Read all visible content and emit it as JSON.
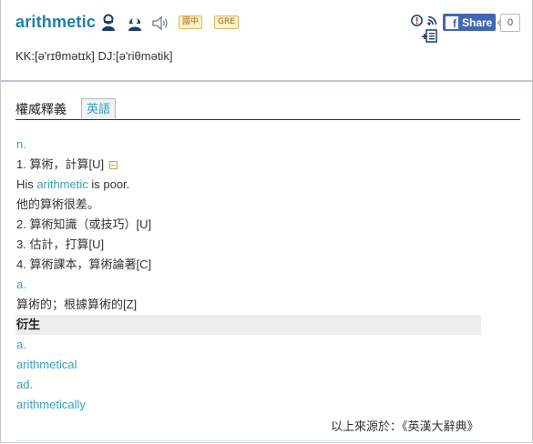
{
  "header": {
    "word": "arithmetic",
    "badges": [
      "國中",
      "GRE"
    ],
    "pronunciation": "KK:[ə'rɪθmətɪk] DJ:[ə'riθmətik]",
    "share_label": "Share",
    "share_count": "0",
    "icons": [
      "male-voice-icon",
      "female-voice-icon",
      "speaker-icon",
      "report-icon",
      "rss-icon",
      "bookmark-add-icon",
      "facebook-icon"
    ],
    "colors": {
      "headword": "#1d7fa6",
      "link": "#3aa0c0",
      "facebook": "#4267b2"
    }
  },
  "tabs": {
    "authority": "權威釋義",
    "english": "英語"
  },
  "entry": {
    "pos_n": "n.",
    "def1_text": "1. 算術，計算[U]",
    "ex1_pre": "His ",
    "ex1_word": "arithmetic",
    "ex1_post": " is poor.",
    "ex1_zh": "他的算術很差。",
    "def2": "2. 算術知識（或技巧）[U]",
    "def3": "3. 估計，打算[U]",
    "def4": "4. 算術課本，算術論著[C]",
    "pos_a": "a.",
    "def_a": "算術的；根據算術的[Z]",
    "derivatives_header": "衍生",
    "d1_pos": "a.",
    "d1_word": "arithmetical",
    "d2_pos": "ad.",
    "d2_word": "arithmetically"
  },
  "source": "以上來源於：《英漢大辭典》"
}
